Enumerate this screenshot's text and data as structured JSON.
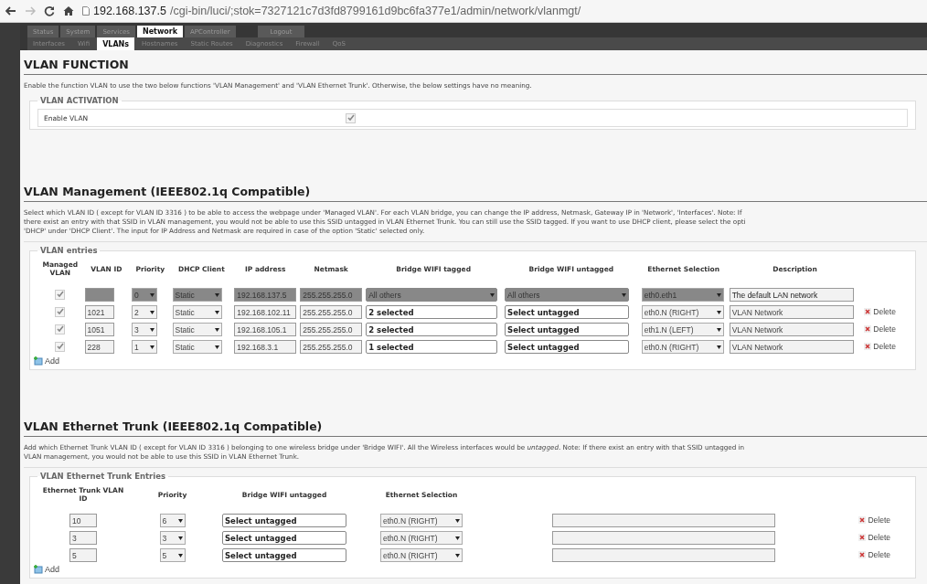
{
  "browser": {
    "url_host": "192.168.137.5",
    "url_path": "/cgi-bin/luci/;stok=7327121c7d3fd8799161d9bc6fa377e1/admin/network/vlanmgt/"
  },
  "top_tabs": [
    {
      "label": "Status",
      "selected": false
    },
    {
      "label": "System",
      "selected": false
    },
    {
      "label": "Services",
      "selected": false
    },
    {
      "label": "Network",
      "selected": true
    },
    {
      "label": "APController",
      "selected": false
    },
    {
      "label": "Logout",
      "selected": false
    }
  ],
  "sub_tabs": [
    {
      "label": "Interfaces",
      "selected": false
    },
    {
      "label": "Wifi",
      "selected": false
    },
    {
      "label": "VLANs",
      "selected": true
    },
    {
      "label": "Hostnames",
      "selected": false
    },
    {
      "label": "Static Routes",
      "selected": false
    },
    {
      "label": "Diagnostics",
      "selected": false
    },
    {
      "label": "Firewall",
      "selected": false
    },
    {
      "label": "QoS",
      "selected": false
    }
  ],
  "function_section": {
    "title": "VLAN FUNCTION",
    "description": [
      "Enable the function VLAN to use the two below functions 'VLAN Management' and 'VLAN Ethernet Trunk'. Otherwise, the below settings have no meaning."
    ],
    "legend": "VLAN ACTIVATION",
    "option": {
      "label": "Enable VLAN",
      "checked": true
    }
  },
  "management": {
    "title": "VLAN Management (IEEE802.1q Compatible)",
    "description": [
      "Select which VLAN ID ( except for VLAN ID 3316 ) to be able to access the webpage under 'Managed VLAN'. For each VLAN bridge, you can change the IP address, Netmask, Gateway IP in 'Network', 'Interfaces'. Note: If",
      "there exist an entry with that SSID in VLAN management, you would not be able to use this SSID untagged in VLAN Ethernet Trunk. You can still use the SSID tagged. If you want to use DHCP client, please select the opti",
      "'DHCP' under 'DHCP Client'. The input for IP Address and Netmask are required in case of the option 'Static' selected only."
    ],
    "legend": "VLAN entries",
    "columns": [
      "Managed VLAN",
      "VLAN ID",
      "Priority",
      "DHCP Client",
      "IP address",
      "Netmask",
      "Bridge WIFI tagged",
      "Bridge WIFI untagged",
      "Ethernet Selection",
      "Description"
    ],
    "rows": [
      {
        "managed": true,
        "disabled": true,
        "vlan_id": "",
        "priority": "0",
        "dhcp": "Static",
        "ip": "192.168.137.5",
        "netmask": "255.255.255.0",
        "tagged": "All others",
        "untagged": "All others",
        "ethernet": "eth0.eth1",
        "description": "The default LAN network"
      },
      {
        "managed": true,
        "disabled": false,
        "vlan_id": "1021",
        "priority": "2",
        "dhcp": "Static",
        "ip": "192.168.102.11",
        "netmask": "255.255.255.0",
        "tagged": "2 selected",
        "untagged": "Select untagged",
        "ethernet": "eth0.N (RIGHT)",
        "description": "VLAN Network",
        "delete": "Delete"
      },
      {
        "managed": true,
        "disabled": false,
        "vlan_id": "1051",
        "priority": "3",
        "dhcp": "Static",
        "ip": "192.168.105.1",
        "netmask": "255.255.255.0",
        "tagged": "2 selected",
        "untagged": "Select untagged",
        "ethernet": "eth1.N (LEFT)",
        "description": "VLAN Network",
        "delete": "Delete"
      },
      {
        "managed": true,
        "disabled": false,
        "vlan_id": "228",
        "priority": "1",
        "dhcp": "Static",
        "ip": "192.168.3.1",
        "netmask": "255.255.255.0",
        "tagged": "1 selected",
        "untagged": "Select untagged",
        "ethernet": "eth0.N (RIGHT)",
        "description": "VLAN Network",
        "delete": "Delete"
      }
    ],
    "add": "Add"
  },
  "trunk": {
    "title": "VLAN Ethernet Trunk (IEEE802.1q Compatible)",
    "description": [
      "Add which Ethernet Trunk VLAN ID ( except for VLAN ID 3316 ) belonging to one wireless bridge under 'Bridge WIFI'. All the Wireless interfaces would be *untagged*. Note: If there exist an entry with that SSID untagged in",
      "VLAN management, you would not be able to use this SSID in VLAN Ethernet Trunk."
    ],
    "legend": "VLAN Ethernet Trunk Entries",
    "columns": [
      "Ethernet Trunk VLAN ID",
      "Priority",
      "Bridge WIFI untagged",
      "Ethernet Selection"
    ],
    "rows": [
      {
        "vlan_id": "10",
        "priority": "6",
        "untagged": "Select untagged",
        "ethernet": "eth0.N (RIGHT)",
        "delete": "Delete"
      },
      {
        "vlan_id": "3",
        "priority": "3",
        "untagged": "Select untagged",
        "ethernet": "eth0.N (RIGHT)",
        "delete": "Delete"
      },
      {
        "vlan_id": "5",
        "priority": "5",
        "untagged": "Select untagged",
        "ethernet": "eth0.N (RIGHT)",
        "delete": "Delete"
      }
    ],
    "add": "Add"
  }
}
